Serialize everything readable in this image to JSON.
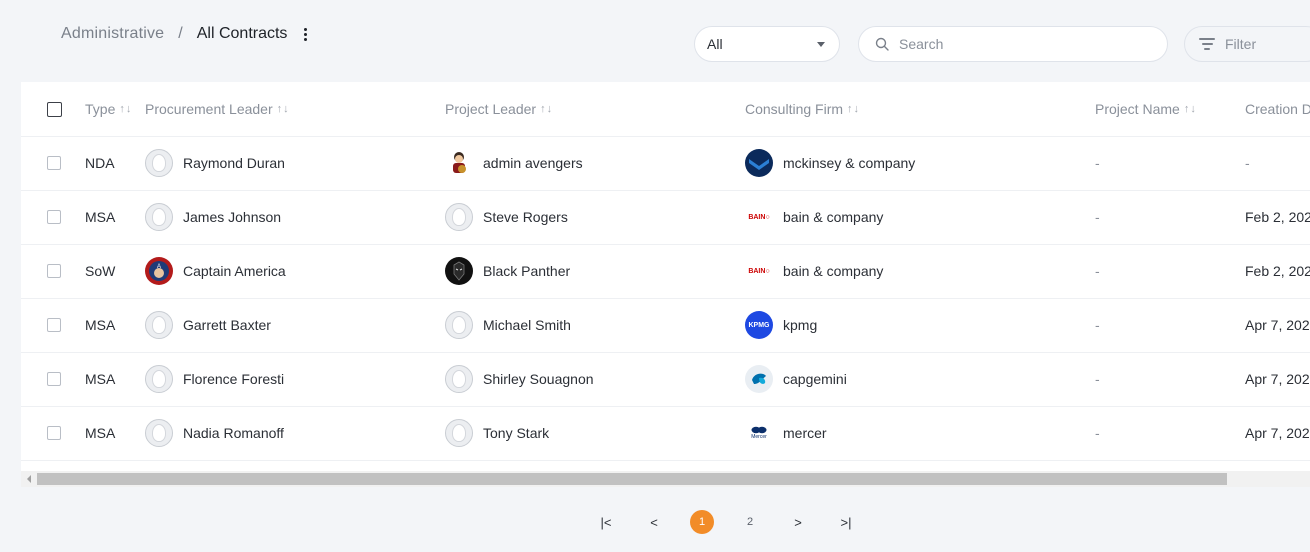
{
  "breadcrumb": {
    "parent": "Administrative",
    "separator": "/",
    "current": "All Contracts"
  },
  "type_select": {
    "value": "All"
  },
  "search": {
    "placeholder": "Search"
  },
  "filter": {
    "label": "Filter"
  },
  "table": {
    "columns": {
      "type": "Type",
      "procurement_leader": "Procurement Leader",
      "project_leader": "Project Leader",
      "consulting_firm": "Consulting Firm",
      "project_name": "Project Name",
      "creation_date": "Creation D"
    },
    "sort_glyph": "↑↓",
    "rows": [
      {
        "type": "NDA",
        "procurement_leader": "Raymond Duran",
        "project_leader": "admin avengers",
        "consulting_firm": "mckinsey & company",
        "project_name": "-",
        "creation_date": "-"
      },
      {
        "type": "MSA",
        "procurement_leader": "James Johnson",
        "project_leader": "Steve Rogers",
        "consulting_firm": "bain & company",
        "project_name": "-",
        "creation_date": "Feb 2, 202"
      },
      {
        "type": "SoW",
        "procurement_leader": "Captain America",
        "project_leader": "Black Panther",
        "consulting_firm": "bain & company",
        "project_name": "-",
        "creation_date": "Feb 2, 202"
      },
      {
        "type": "MSA",
        "procurement_leader": "Garrett Baxter",
        "project_leader": "Michael Smith",
        "consulting_firm": "kpmg",
        "project_name": "-",
        "creation_date": "Apr 7, 202"
      },
      {
        "type": "MSA",
        "procurement_leader": "Florence Foresti",
        "project_leader": "Shirley Souagnon",
        "consulting_firm": "capgemini",
        "project_name": "-",
        "creation_date": "Apr 7, 202"
      },
      {
        "type": "MSA",
        "procurement_leader": "Nadia Romanoff",
        "project_leader": "Tony Stark",
        "consulting_firm": "mercer",
        "project_name": "-",
        "creation_date": "Apr 7, 202"
      }
    ]
  },
  "logos": {
    "bain": "BAIN",
    "kpmg": "KPMG",
    "mercer": "Mercer"
  },
  "pagination": {
    "first": "|<",
    "prev": "<",
    "pages": [
      "1",
      "2"
    ],
    "current": "1",
    "next": ">",
    "last": ">|"
  },
  "colors": {
    "accent": "#f28c28",
    "background": "#f3f5f8",
    "mckinsey": "#0b2a5b",
    "bain": "#cc0000",
    "kpmg": "#1e49e2",
    "capgemini": "#0070ad"
  }
}
